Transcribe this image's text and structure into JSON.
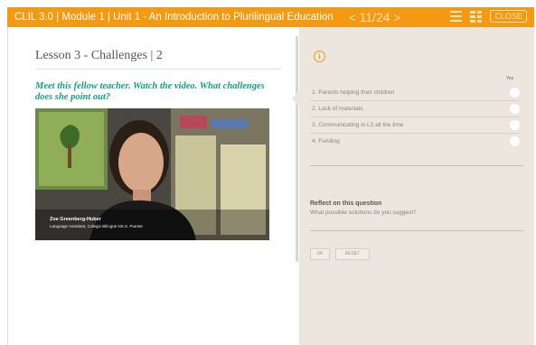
{
  "topbar": {
    "course_title": "CLIL 3.0 | Module 1 | Unit 1 - An Introduction to Plurilingual Education",
    "prev_label": "<",
    "page_indicator": "11/24",
    "next_label": ">",
    "close_label": "CLOSE"
  },
  "lesson": {
    "title": "Lesson 3 - Challenges | 2",
    "prompt": "Meet this fellow teacher. Watch the video. What challenges does she point out?",
    "video": {
      "speaker_name": "Zoe Greenberg-Huber",
      "speaker_role": "Language Assistant, Colegio Bilingüe NS.S. Puente"
    }
  },
  "quiz": {
    "column_header": "Yes",
    "options": [
      "1. Parents helping their children",
      "2. Lack of materials",
      "3. Communicating in L2 all the time",
      "4. Funding"
    ],
    "reflect_title": "Reflect on this question",
    "reflect_question": "What possible solutions do you suggest?",
    "ok_label": "OK",
    "reset_label": "RESET"
  },
  "colors": {
    "brand_orange": "#f39a12",
    "prompt_teal": "#16a085",
    "panel_beige": "#ece6df"
  }
}
